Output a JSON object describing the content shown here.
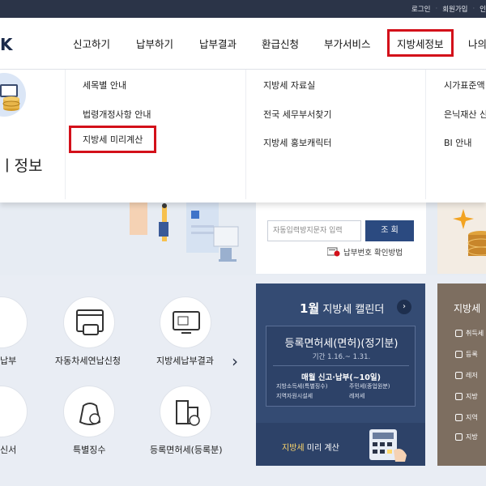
{
  "topbar": {
    "links": [
      "로그인",
      "회원가입",
      "인"
    ]
  },
  "gnb": {
    "logo": "K",
    "items": [
      "신고하기",
      "납부하기",
      "납부결과",
      "환급신청",
      "부가서비스",
      "지방세정보",
      "나의"
    ]
  },
  "mega": {
    "category_title": "지방세정보",
    "cat_title_visible": "ㅣ정보",
    "col1": [
      "세목별 안내",
      "법령개정사항 안내",
      "지방세 미리계산"
    ],
    "col2": [
      "지방세 자료실",
      "전국 세무부서찾기",
      "지방세 홍보캐릭터"
    ],
    "col3": [
      "시가표준액",
      "은닉재산 신",
      "BI 안내"
    ]
  },
  "search": {
    "placeholder": "자동입력방지문자 입력",
    "button": "조 회",
    "help": "납부번호 확인방법"
  },
  "services": [
    {
      "label": "납부"
    },
    {
      "label": "자동차세연납신청"
    },
    {
      "label": "지방세납부결과"
    },
    {
      "label": "신서"
    },
    {
      "label": "특별징수"
    },
    {
      "label": "등록면허세(등록분)"
    }
  ],
  "calendar": {
    "month": "1월",
    "title": "지방세 캘린더",
    "event": "등록면허세(면허)(정기분)",
    "period": "기간 1.16.~ 1.31.",
    "monthly_title": "매월 신고·납부(~10일)",
    "taxes": [
      "지방소득세(특별징수)",
      "주민세(종업원분)",
      "지역자원시설세",
      "레저세"
    ],
    "calc_highlight": "지방세",
    "calc_rest": "미리 계산"
  },
  "local_panel": {
    "title": "지방세",
    "items": [
      "취득세",
      "등록",
      "레저",
      "지방",
      "지역",
      "지방"
    ]
  }
}
